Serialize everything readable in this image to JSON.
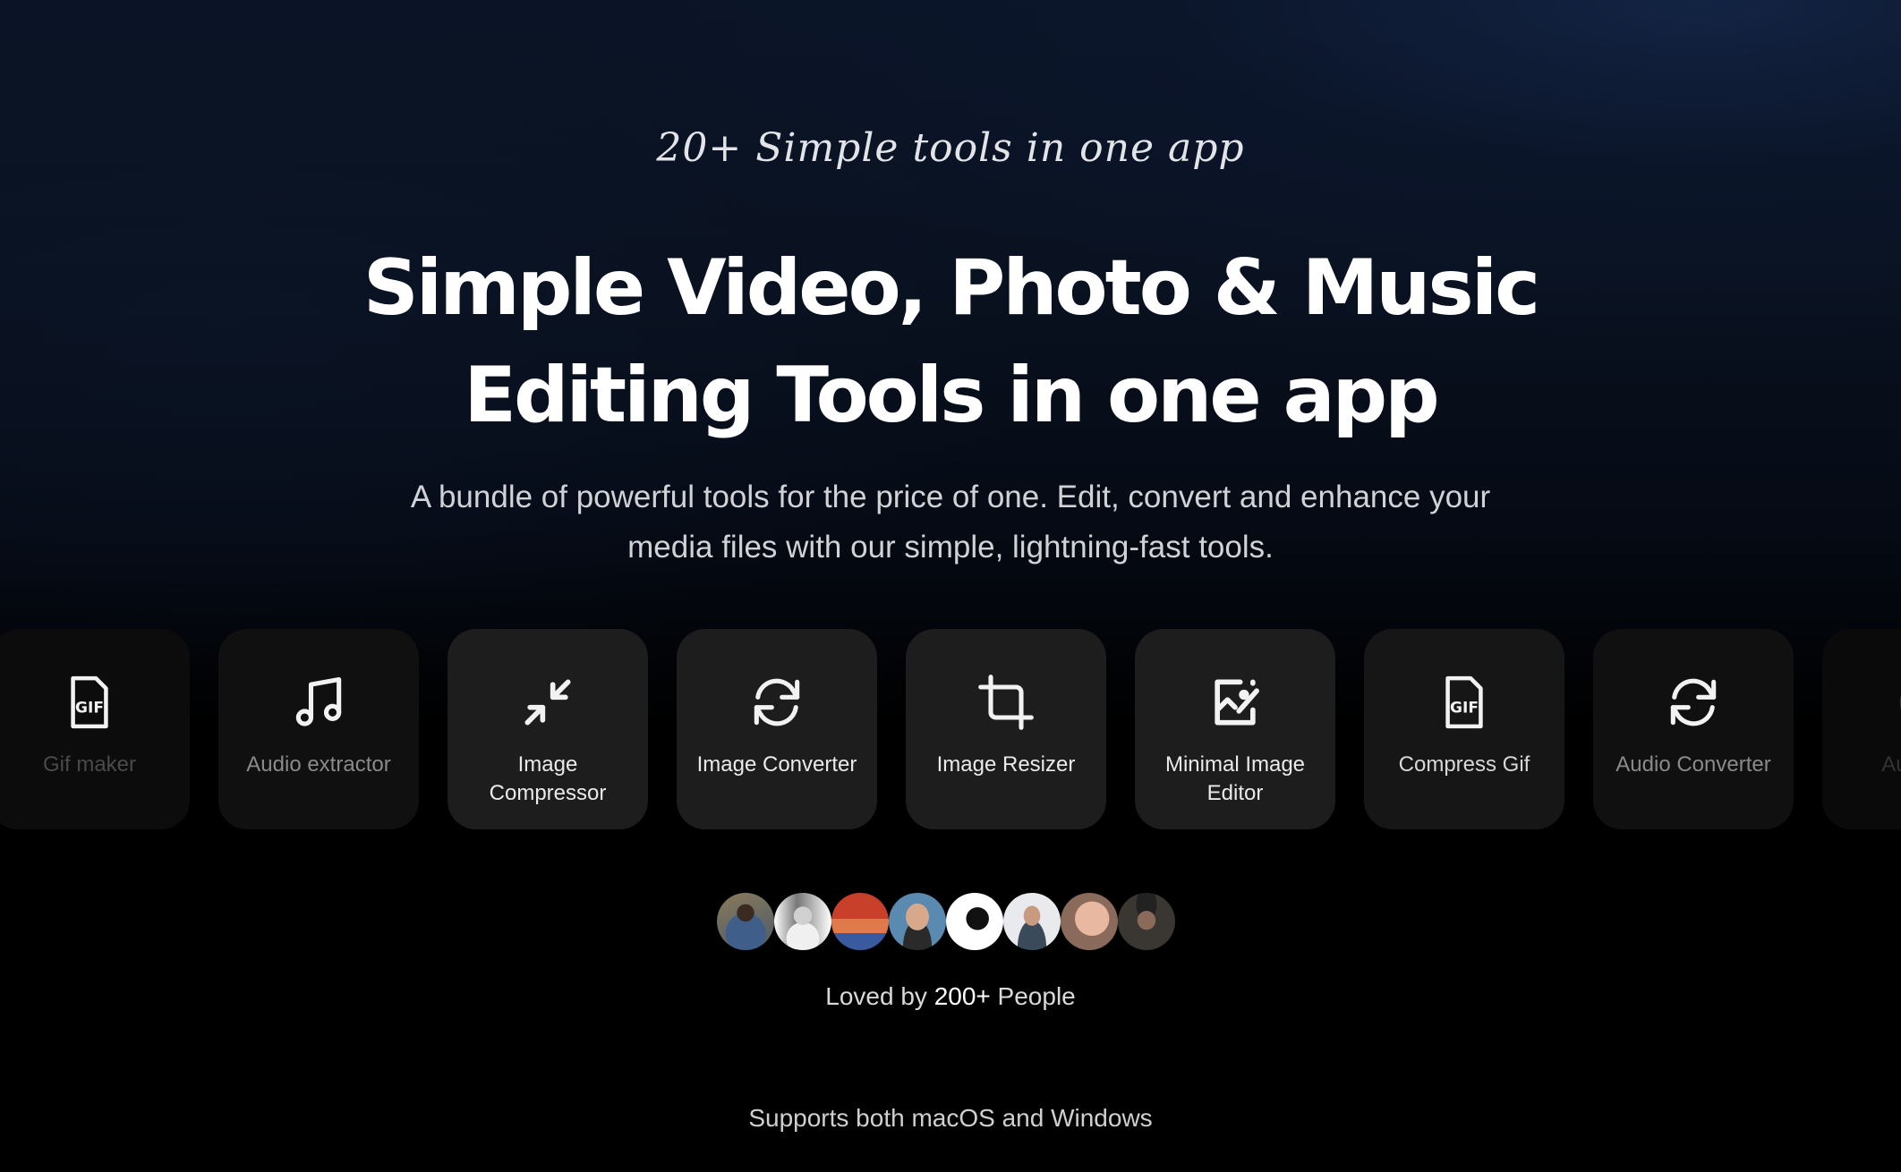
{
  "hero": {
    "tagline": "20+ Simple tools in one app",
    "headline_line1": "Simple Video, Photo & Music",
    "headline_line2": "Editing Tools in one app",
    "subtitle_line1": "A bundle of powerful tools for the price of one. Edit, convert and enhance your",
    "subtitle_line2": "media files with our simple, lightning-fast tools."
  },
  "tools": [
    {
      "label": "Gif maker",
      "icon": "gif-file-icon"
    },
    {
      "label": "Audio extractor",
      "icon": "music-note-icon"
    },
    {
      "label": "Image Compressor",
      "icon": "compress-arrows-icon"
    },
    {
      "label": "Image Converter",
      "icon": "refresh-arrows-icon"
    },
    {
      "label": "Image Resizer",
      "icon": "crop-icon"
    },
    {
      "label": "Minimal Image Editor",
      "icon": "image-edit-icon"
    },
    {
      "label": "Compress Gif",
      "icon": "gif-file-icon"
    },
    {
      "label": "Audio Converter",
      "icon": "refresh-arrows-icon"
    },
    {
      "label": "Audio",
      "icon": "audio-icon"
    }
  ],
  "social_proof": {
    "avatar_count": 8,
    "loved_prefix": "Loved by ",
    "loved_count": "200+",
    "loved_suffix": " People"
  },
  "platforms": "Supports both macOS and Windows",
  "colors": {
    "background": "#000000",
    "card": "#1d1d1d",
    "text": "#ffffff",
    "muted_text": "#d0d2d6",
    "accent_navy": "#0b1426"
  }
}
